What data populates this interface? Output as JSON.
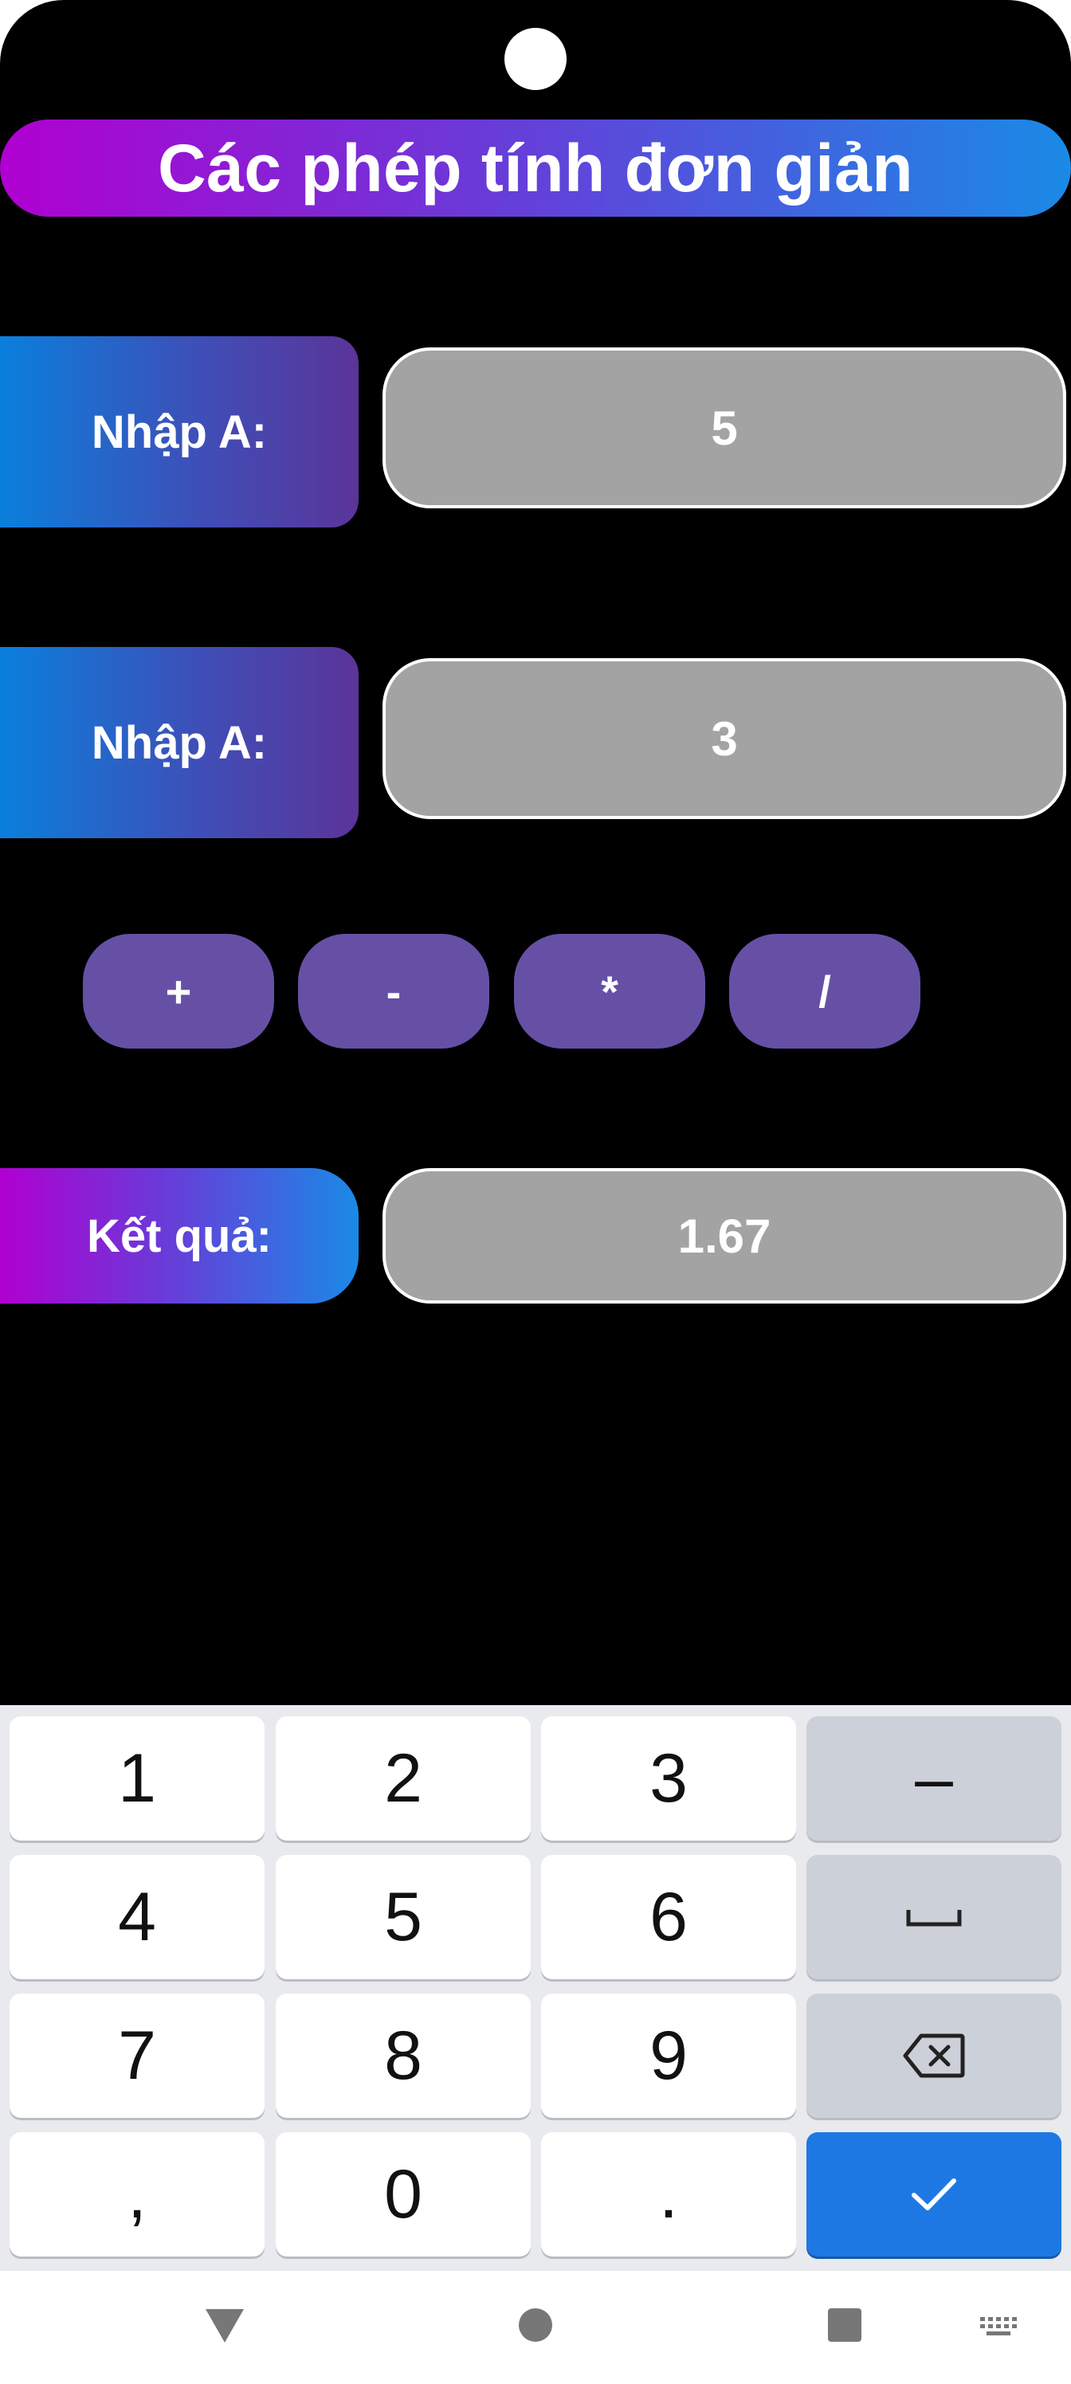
{
  "header": {
    "title": "Các phép tính đơn giản"
  },
  "inputs": [
    {
      "label": "Nhập A:",
      "value": "5"
    },
    {
      "label": "Nhập A:",
      "value": "3"
    }
  ],
  "operations": [
    "+",
    "-",
    "*",
    "/"
  ],
  "result": {
    "label": "Kết quả:",
    "value": "1.67"
  },
  "keyboard": {
    "rows": [
      [
        "1",
        "2",
        "3",
        "–"
      ],
      [
        "4",
        "5",
        "6",
        "space-icon"
      ],
      [
        "7",
        "8",
        "9",
        "backspace-icon"
      ],
      [
        ",",
        "0",
        ".",
        "check-icon"
      ]
    ]
  },
  "navbar": {
    "icons": [
      "back-icon",
      "home-icon",
      "recents-icon",
      "keyboard-switch-icon"
    ]
  },
  "colors": {
    "background": "#000000",
    "field": "#a3a3a3",
    "op_button": "#6650a6",
    "enter_key": "#1e78e4",
    "gradient_magenta": "#b000d0",
    "gradient_blue": "#1a8ae6"
  }
}
